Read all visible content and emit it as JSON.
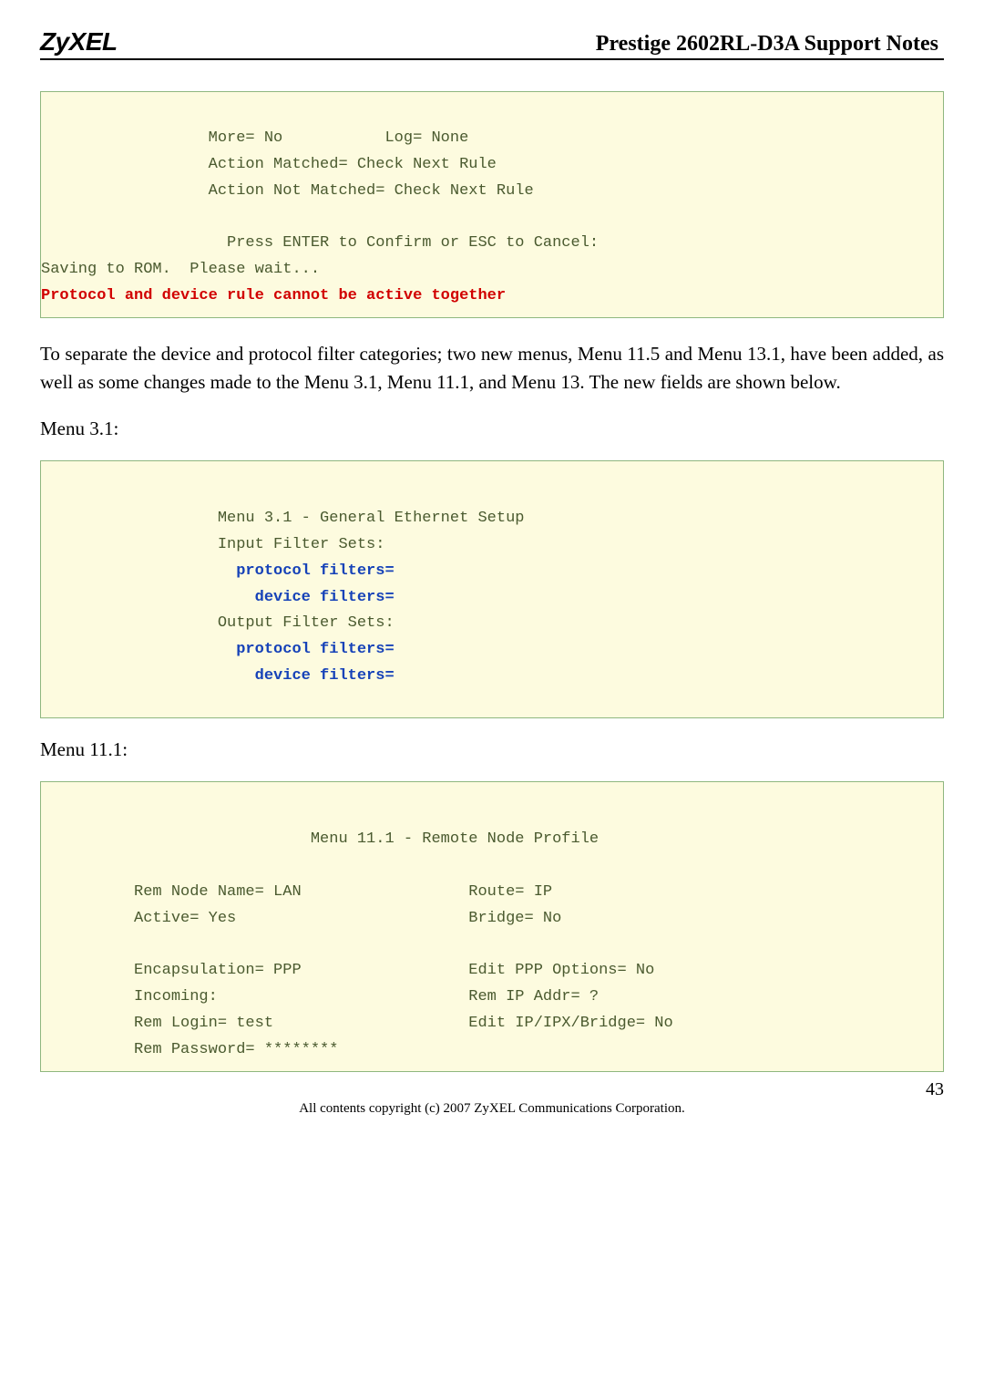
{
  "header": {
    "logo": "ZyXEL",
    "title": "Prestige 2602RL-D3A Support Notes"
  },
  "box1": {
    "l1": "                  More= No           Log= None",
    "l2": "                  Action Matched= Check Next Rule",
    "l3": "                  Action Not Matched= Check Next Rule",
    "l4": "",
    "l5": "                    Press ENTER to Confirm or ESC to Cancel:",
    "l6": "Saving to ROM.  Please wait...",
    "l7": "Protocol and device rule cannot be active together"
  },
  "para1": "To separate the device and protocol filter categories; two new menus, Menu 11.5 and Menu 13.1, have been added, as well as some changes made to the Menu 3.1, Menu 11.1, and Menu 13. The new fields are shown below.",
  "label_menu31": "Menu 3.1:",
  "box2": {
    "l1": "                   Menu 3.1 - General Ethernet Setup",
    "l2": "                   Input Filter Sets:",
    "l3": "                     protocol filters=",
    "l4": "                       device filters=",
    "l5": "                   Output Filter Sets:",
    "l6": "                     protocol filters=",
    "l7": "                       device filters="
  },
  "label_menu111": "Menu 11.1:",
  "box3": {
    "l1": "                             Menu 11.1 - Remote Node Profile",
    "l2": "",
    "l3": "          Rem Node Name= LAN                  Route= IP",
    "l4": "          Active= Yes                         Bridge= No",
    "l5": "",
    "l6": "          Encapsulation= PPP                  Edit PPP Options= No",
    "l7": "          Incoming:                           Rem IP Addr= ?",
    "l8": "          Rem Login= test                     Edit IP/IPX/Bridge= No",
    "l9": "          Rem Password= ********"
  },
  "footer": {
    "copyright": "All contents copyright (c) 2007 ZyXEL Communications Corporation.",
    "pagenum": "43"
  }
}
